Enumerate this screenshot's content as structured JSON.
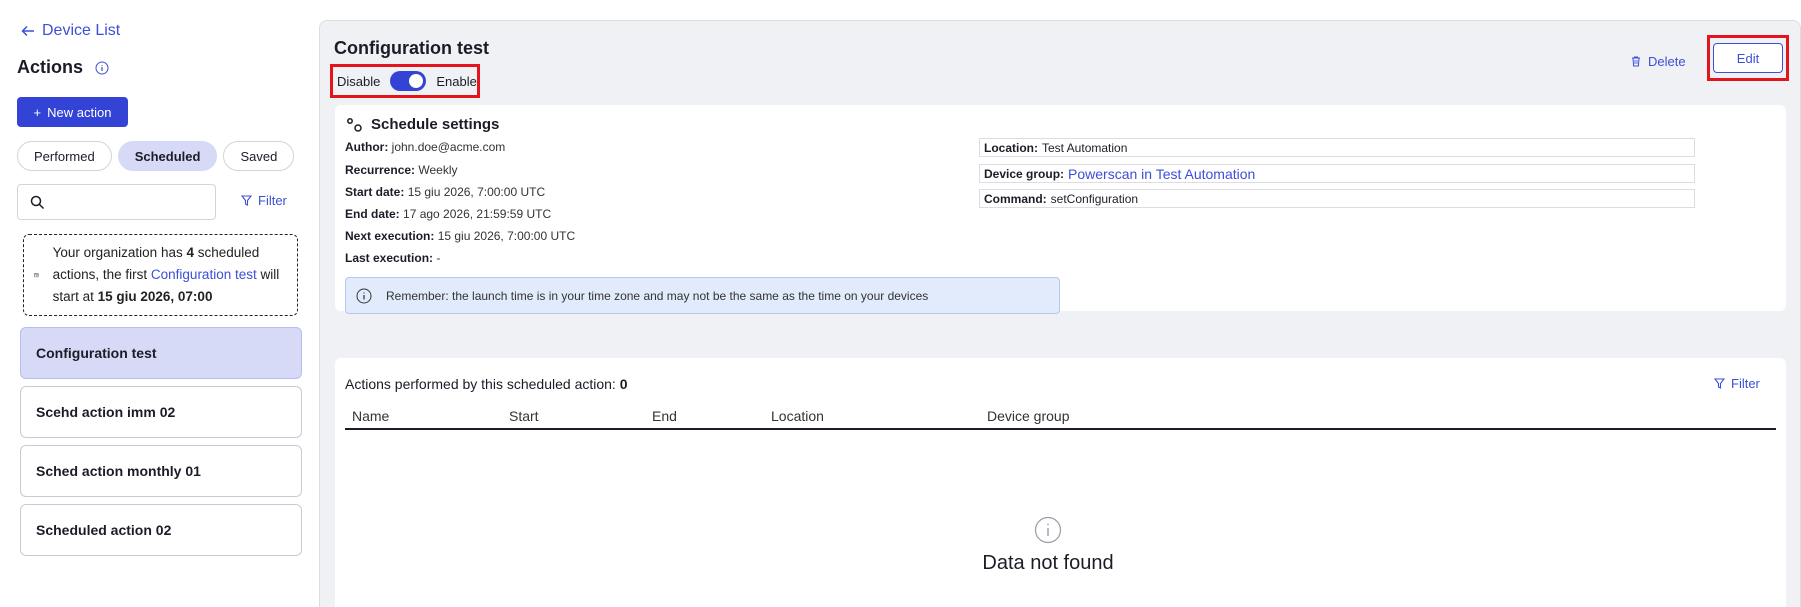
{
  "sidebar": {
    "back_label": "Device List",
    "title": "Actions",
    "new_action_label": "New action",
    "tabs": [
      {
        "label": "Performed"
      },
      {
        "label": "Scheduled"
      },
      {
        "label": "Saved"
      }
    ],
    "search": {
      "placeholder": "",
      "value": ""
    },
    "filter_label": "Filter",
    "notice": {
      "prefix": "Your organization has ",
      "count": "4",
      "middle": " scheduled actions, the first ",
      "link": "Configuration test",
      "suffix": " will start at ",
      "datetime": "15 giu 2026, 07:00"
    },
    "items": [
      {
        "label": "Configuration test"
      },
      {
        "label": "Scehd action imm 02"
      },
      {
        "label": "Sched action monthly 01"
      },
      {
        "label": "Scheduled action 02"
      }
    ]
  },
  "main": {
    "title": "Configuration test",
    "toggle": {
      "off_label": "Disable",
      "on_label": "Enable",
      "enabled": true
    },
    "delete_label": "Delete",
    "edit_label": "Edit",
    "schedule": {
      "title": "Schedule settings",
      "author": {
        "label": "Author:",
        "value": "john.doe@acme.com"
      },
      "recurrence": {
        "label": "Recurrence:",
        "value": "Weekly"
      },
      "start": {
        "label": "Start date:",
        "value": "15 giu 2026, 7:00:00 UTC"
      },
      "end": {
        "label": "End date:",
        "value": "17 ago 2026, 21:59:59 UTC"
      },
      "next": {
        "label": "Next execution:",
        "value": "15 giu 2026, 7:00:00 UTC"
      },
      "last": {
        "label": "Last execution:",
        "value": "-"
      },
      "location": {
        "label": "Location:",
        "value": "Test Automation"
      },
      "device_group": {
        "label": "Device group:",
        "value": "Powerscan in Test Automation"
      },
      "command": {
        "label": "Command:",
        "value": "setConfiguration"
      },
      "reminder": "Remember: the launch time is in your time zone and may not be the same as the time on your devices"
    },
    "history": {
      "title": "Actions performed by this scheduled action: ",
      "count": "0",
      "filter_label": "Filter",
      "columns": [
        "Name",
        "Start",
        "End",
        "Location",
        "Device group"
      ],
      "empty_text": "Data not found"
    }
  },
  "colors": {
    "accent": "#3343d6",
    "highlight": "#e3141e",
    "selected": "#d6daf6"
  }
}
